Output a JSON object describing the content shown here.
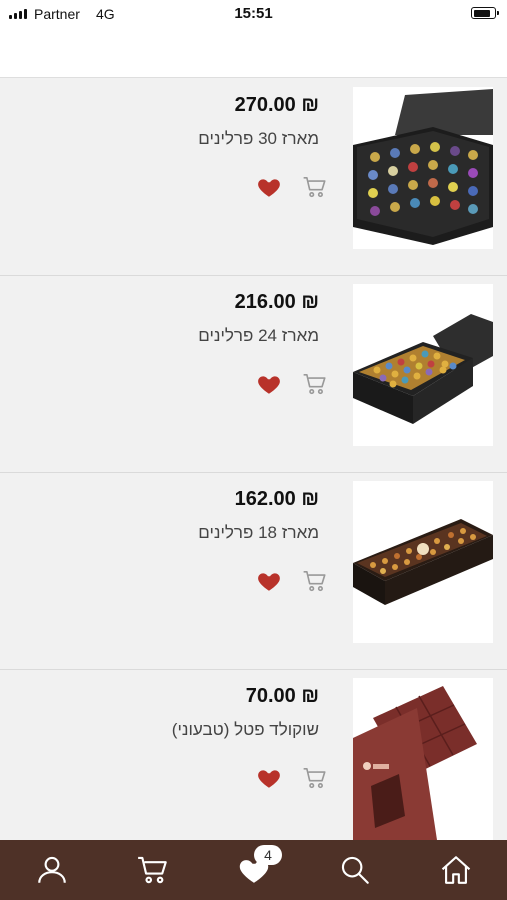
{
  "status_bar": {
    "carrier": "Partner",
    "network": "4G",
    "time": "15:51"
  },
  "products": [
    {
      "price": "₪ 270.00",
      "title": "מארז 30 פרלינים",
      "image": "praline-box-30"
    },
    {
      "price": "₪ 216.00",
      "title": "מארז 24 פרלינים",
      "image": "praline-box-24"
    },
    {
      "price": "₪ 162.00",
      "title": "מארז 18 פרלינים",
      "image": "praline-box-18"
    },
    {
      "price": "₪ 70.00",
      "title": "שוקולד פטל (טבעוני)",
      "image": "raspberry-chocolate-bar"
    }
  ],
  "bottom_nav": {
    "wishlist_count": "4",
    "items": [
      "user-icon",
      "cart-icon",
      "heart-icon",
      "search-icon",
      "home-icon"
    ]
  },
  "colors": {
    "nav_background": "#4e3127",
    "heart": "#b8322a",
    "cart_outline": "#999999",
    "page_background": "#f1f1f1"
  }
}
